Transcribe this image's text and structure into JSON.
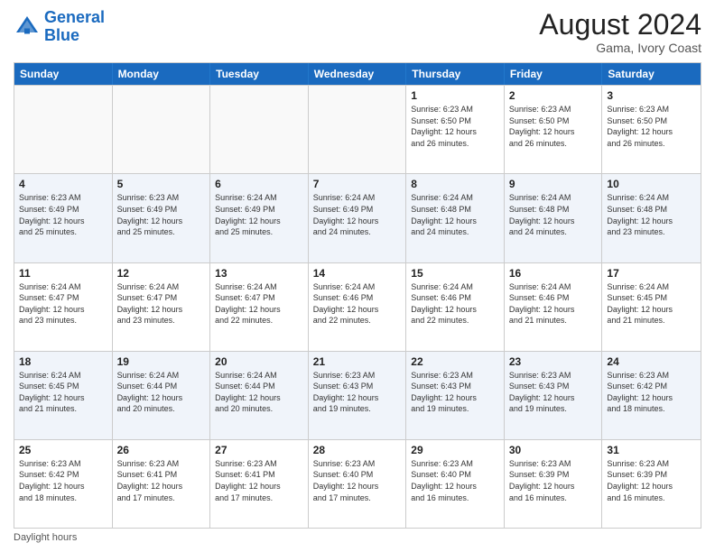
{
  "header": {
    "logo_line1": "General",
    "logo_line2": "Blue",
    "main_title": "August 2024",
    "subtitle": "Gama, Ivory Coast"
  },
  "calendar": {
    "days_of_week": [
      "Sunday",
      "Monday",
      "Tuesday",
      "Wednesday",
      "Thursday",
      "Friday",
      "Saturday"
    ],
    "rows": [
      [
        {
          "day": "",
          "empty": true
        },
        {
          "day": "",
          "empty": true
        },
        {
          "day": "",
          "empty": true
        },
        {
          "day": "",
          "empty": true
        },
        {
          "day": "1",
          "info": "Sunrise: 6:23 AM\nSunset: 6:50 PM\nDaylight: 12 hours\nand 26 minutes."
        },
        {
          "day": "2",
          "info": "Sunrise: 6:23 AM\nSunset: 6:50 PM\nDaylight: 12 hours\nand 26 minutes."
        },
        {
          "day": "3",
          "info": "Sunrise: 6:23 AM\nSunset: 6:50 PM\nDaylight: 12 hours\nand 26 minutes."
        }
      ],
      [
        {
          "day": "4",
          "info": "Sunrise: 6:23 AM\nSunset: 6:49 PM\nDaylight: 12 hours\nand 25 minutes."
        },
        {
          "day": "5",
          "info": "Sunrise: 6:23 AM\nSunset: 6:49 PM\nDaylight: 12 hours\nand 25 minutes."
        },
        {
          "day": "6",
          "info": "Sunrise: 6:24 AM\nSunset: 6:49 PM\nDaylight: 12 hours\nand 25 minutes."
        },
        {
          "day": "7",
          "info": "Sunrise: 6:24 AM\nSunset: 6:49 PM\nDaylight: 12 hours\nand 24 minutes."
        },
        {
          "day": "8",
          "info": "Sunrise: 6:24 AM\nSunset: 6:48 PM\nDaylight: 12 hours\nand 24 minutes."
        },
        {
          "day": "9",
          "info": "Sunrise: 6:24 AM\nSunset: 6:48 PM\nDaylight: 12 hours\nand 24 minutes."
        },
        {
          "day": "10",
          "info": "Sunrise: 6:24 AM\nSunset: 6:48 PM\nDaylight: 12 hours\nand 23 minutes."
        }
      ],
      [
        {
          "day": "11",
          "info": "Sunrise: 6:24 AM\nSunset: 6:47 PM\nDaylight: 12 hours\nand 23 minutes."
        },
        {
          "day": "12",
          "info": "Sunrise: 6:24 AM\nSunset: 6:47 PM\nDaylight: 12 hours\nand 23 minutes."
        },
        {
          "day": "13",
          "info": "Sunrise: 6:24 AM\nSunset: 6:47 PM\nDaylight: 12 hours\nand 22 minutes."
        },
        {
          "day": "14",
          "info": "Sunrise: 6:24 AM\nSunset: 6:46 PM\nDaylight: 12 hours\nand 22 minutes."
        },
        {
          "day": "15",
          "info": "Sunrise: 6:24 AM\nSunset: 6:46 PM\nDaylight: 12 hours\nand 22 minutes."
        },
        {
          "day": "16",
          "info": "Sunrise: 6:24 AM\nSunset: 6:46 PM\nDaylight: 12 hours\nand 21 minutes."
        },
        {
          "day": "17",
          "info": "Sunrise: 6:24 AM\nSunset: 6:45 PM\nDaylight: 12 hours\nand 21 minutes."
        }
      ],
      [
        {
          "day": "18",
          "info": "Sunrise: 6:24 AM\nSunset: 6:45 PM\nDaylight: 12 hours\nand 21 minutes."
        },
        {
          "day": "19",
          "info": "Sunrise: 6:24 AM\nSunset: 6:44 PM\nDaylight: 12 hours\nand 20 minutes."
        },
        {
          "day": "20",
          "info": "Sunrise: 6:24 AM\nSunset: 6:44 PM\nDaylight: 12 hours\nand 20 minutes."
        },
        {
          "day": "21",
          "info": "Sunrise: 6:23 AM\nSunset: 6:43 PM\nDaylight: 12 hours\nand 19 minutes."
        },
        {
          "day": "22",
          "info": "Sunrise: 6:23 AM\nSunset: 6:43 PM\nDaylight: 12 hours\nand 19 minutes."
        },
        {
          "day": "23",
          "info": "Sunrise: 6:23 AM\nSunset: 6:43 PM\nDaylight: 12 hours\nand 19 minutes."
        },
        {
          "day": "24",
          "info": "Sunrise: 6:23 AM\nSunset: 6:42 PM\nDaylight: 12 hours\nand 18 minutes."
        }
      ],
      [
        {
          "day": "25",
          "info": "Sunrise: 6:23 AM\nSunset: 6:42 PM\nDaylight: 12 hours\nand 18 minutes."
        },
        {
          "day": "26",
          "info": "Sunrise: 6:23 AM\nSunset: 6:41 PM\nDaylight: 12 hours\nand 17 minutes."
        },
        {
          "day": "27",
          "info": "Sunrise: 6:23 AM\nSunset: 6:41 PM\nDaylight: 12 hours\nand 17 minutes."
        },
        {
          "day": "28",
          "info": "Sunrise: 6:23 AM\nSunset: 6:40 PM\nDaylight: 12 hours\nand 17 minutes."
        },
        {
          "day": "29",
          "info": "Sunrise: 6:23 AM\nSunset: 6:40 PM\nDaylight: 12 hours\nand 16 minutes."
        },
        {
          "day": "30",
          "info": "Sunrise: 6:23 AM\nSunset: 6:39 PM\nDaylight: 12 hours\nand 16 minutes."
        },
        {
          "day": "31",
          "info": "Sunrise: 6:23 AM\nSunset: 6:39 PM\nDaylight: 12 hours\nand 16 minutes."
        }
      ]
    ]
  },
  "footer": {
    "note": "Daylight hours"
  }
}
